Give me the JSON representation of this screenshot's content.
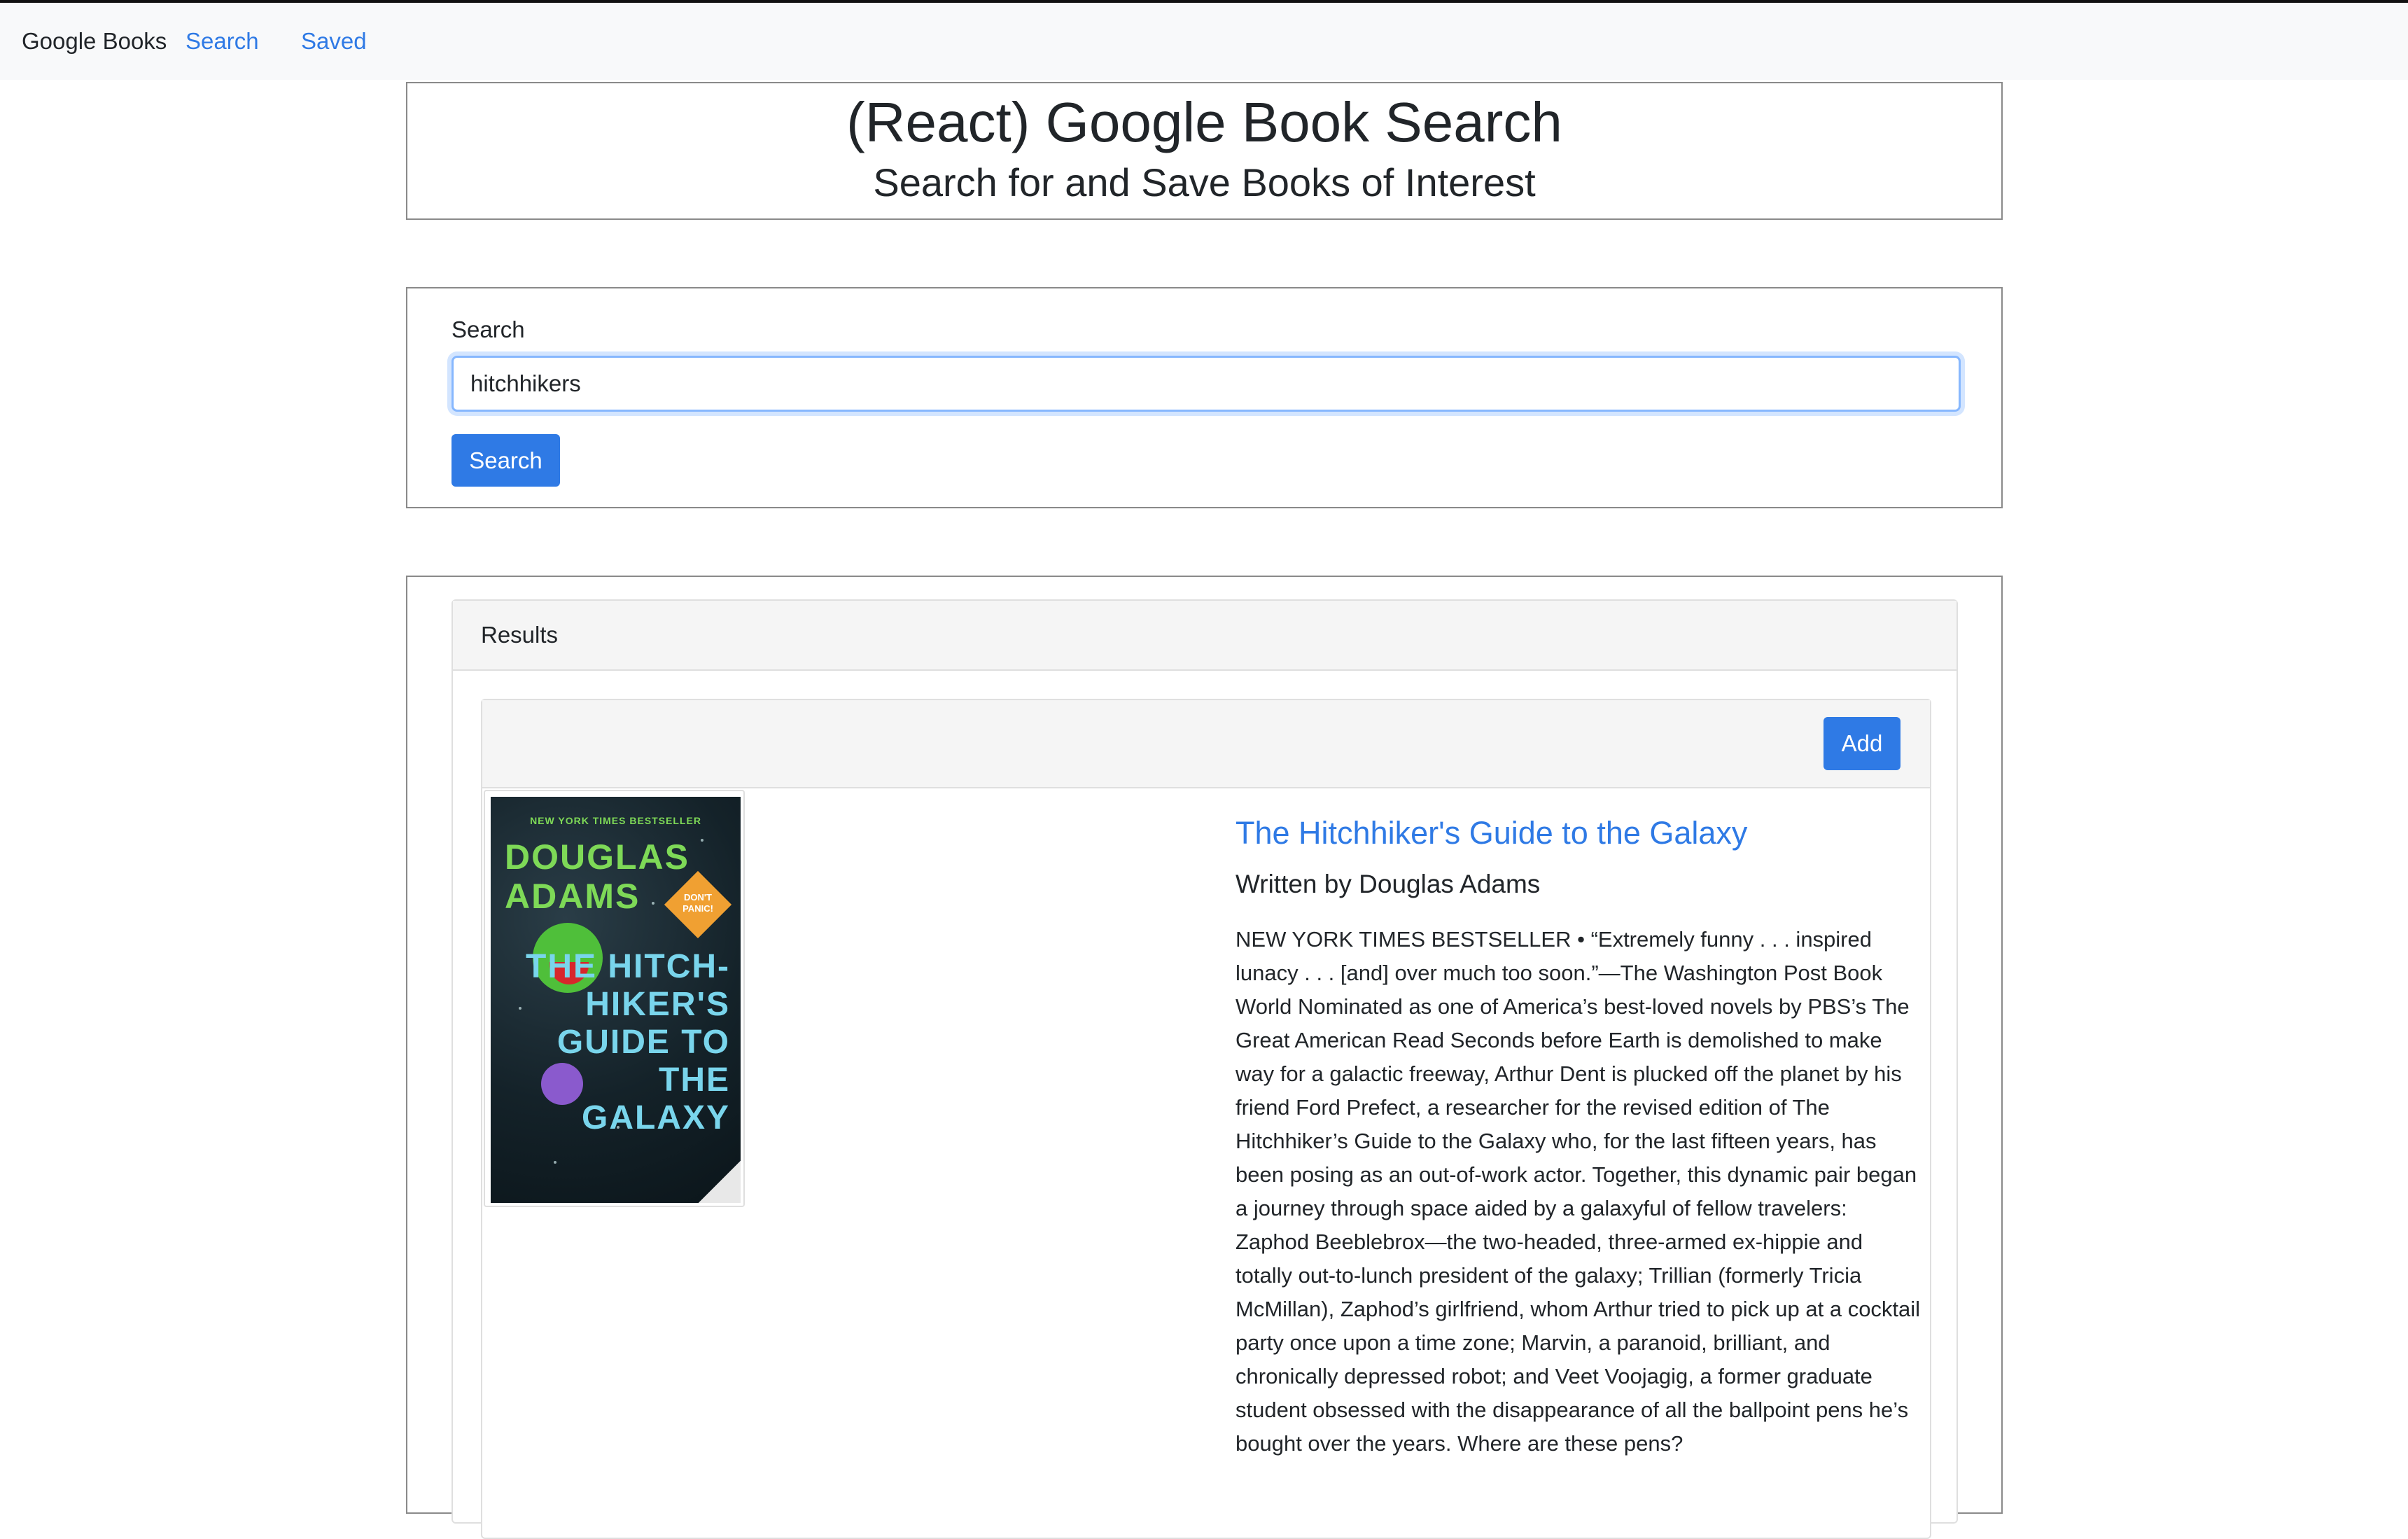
{
  "navbar": {
    "brand": "Google Books",
    "links": [
      "Search",
      "Saved"
    ]
  },
  "header": {
    "title": "(React) Google Book Search",
    "subtitle": "Search for and Save Books of Interest"
  },
  "search": {
    "label": "Search",
    "value": "hitchhikers",
    "button_label": "Search"
  },
  "results": {
    "title": "Results",
    "books": [
      {
        "add_label": "Add",
        "title": "The Hitchhiker's Guide to the Galaxy",
        "author_line": "Written by Douglas Adams",
        "cover": {
          "top_text": "NEW YORK TIMES BESTSELLER",
          "author": "DOUGLAS ADAMS",
          "badge": "DON'T PANIC!",
          "title": "THE HITCH-HIKER'S GUIDE TO THE GALAXY"
        },
        "description": "NEW YORK TIMES BESTSELLER • “Extremely funny . . . inspired lunacy . . . [and] over much too soon.”—The Washington Post Book World Nominated as one of America’s best-loved novels by PBS’s The Great American Read Seconds before Earth is demolished to make way for a galactic freeway, Arthur Dent is plucked off the planet by his friend Ford Prefect, a researcher for the revised edition of The Hitchhiker’s Guide to the Galaxy who, for the last fifteen years, has been posing as an out-of-work actor. Together, this dynamic pair began a journey through space aided by a galaxyful of fellow travelers: Zaphod Beeblebrox—the two-headed, three-armed ex-hippie and totally out-to-lunch president of the galaxy; Trillian (formerly Tricia McMillan), Zaphod’s girlfriend, whom Arthur tried to pick up at a cocktail party once upon a time zone; Marvin, a paranoid, brilliant, and chronically depressed robot; and Veet Voojagig, a former graduate student obsessed with the disappearance of all the ballpoint pens he’s bought over the years. Where are these pens?"
      }
    ]
  },
  "colors": {
    "primary": "#2f7ae5",
    "navbar_bg": "#f8f9fa",
    "card_header_bg": "#f5f5f5"
  }
}
